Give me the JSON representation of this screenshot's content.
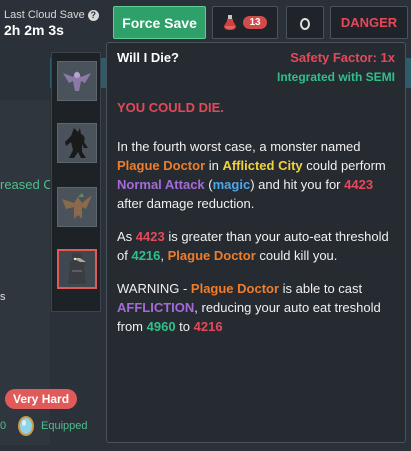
{
  "header": {
    "last_save_label": "Last Cloud Save",
    "last_save_time": "2h 2m 3s",
    "force_save_label": "Force Save",
    "potion_count": "13",
    "danger_label": "DANGER"
  },
  "background": {
    "eased_text": "reased C",
    "s_text": "s",
    "difficulty_badge": "Very Hard",
    "zero_text": "0",
    "equipped_text": "Equipped"
  },
  "monsters": {
    "icons": [
      "dragon-purple-icon",
      "werewolf-icon",
      "wyvern-icon",
      "plague-doctor-icon"
    ],
    "selected_index": 3
  },
  "tooltip": {
    "title": "Will I Die?",
    "safety_factor": "Safety Factor: 1x",
    "integration": "Integrated with SEMI",
    "warning_head": "YOU COULD DIE.",
    "p1": {
      "t1": "In the fourth worst case, a monster named ",
      "monster": "Plague Doctor",
      "t2": " in ",
      "area": "Afflicted City",
      "t3": " could perform ",
      "attack": "Normal Attack",
      "t4": " (",
      "style": "magic",
      "t5": ") and hit you for ",
      "damage": "4423",
      "t6": " after damage reduction."
    },
    "p2": {
      "t1": "As ",
      "damage": "4423",
      "t2": " is greater than your auto-eat threshold of ",
      "threshold": "4216",
      "t3": ", ",
      "monster": "Plague Doctor",
      "t4": " could kill you."
    },
    "p3": {
      "t1": "WARNING - ",
      "monster": "Plague Doctor",
      "t2": " is able to cast ",
      "spell": "AFFLICTION",
      "t3": ", reducing your auto eat treshold from ",
      "from": "4960",
      "t4": " to ",
      "to": "4216"
    }
  }
}
